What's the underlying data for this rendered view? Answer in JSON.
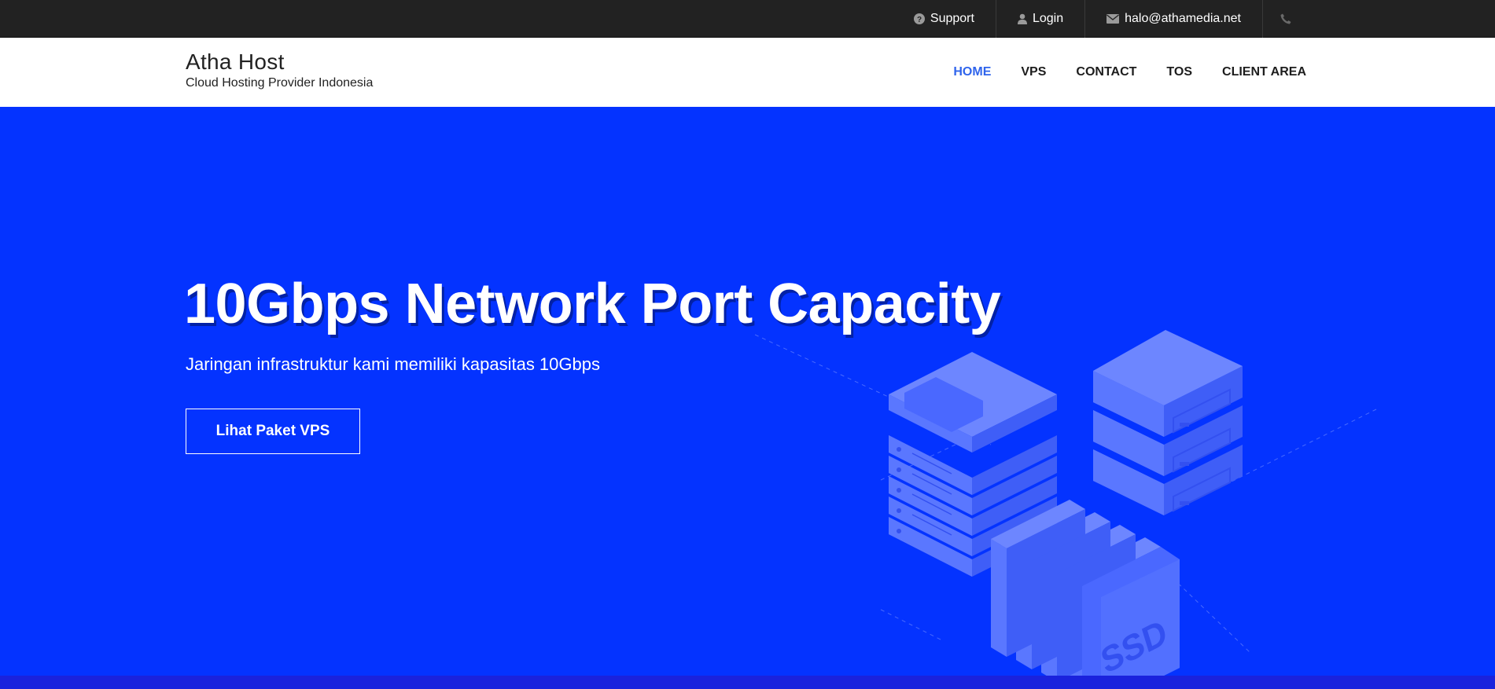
{
  "topbar": {
    "support": "Support",
    "login": "Login",
    "email": "halo@athamedia.net"
  },
  "brand": {
    "title": "Atha Host",
    "subtitle": "Cloud Hosting Provider Indonesia"
  },
  "nav": {
    "items": [
      "HOME",
      "VPS",
      "CONTACT",
      "TOS",
      "CLIENT AREA"
    ],
    "active": "HOME"
  },
  "hero": {
    "title": "10Gbps Network Port Capacity",
    "subtitle": "Jaringan infrastruktur kami memiliki kapasitas 10Gbps",
    "button": "Lihat Paket VPS",
    "illustration_label": "SSD"
  },
  "colors": {
    "topbar": "#222222",
    "hero_bg": "#0433ff",
    "nav_active": "#2f64ec",
    "server_light": "#6d86ff",
    "server_mid": "#4a68ff",
    "server_dark": "#3350f0"
  },
  "icons": [
    "question-circle-icon",
    "user-icon",
    "envelope-icon",
    "phone-icon"
  ]
}
